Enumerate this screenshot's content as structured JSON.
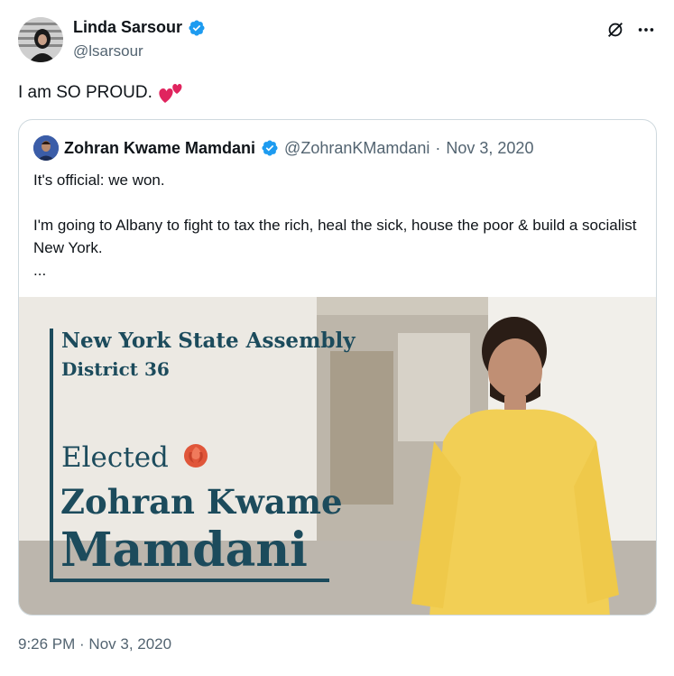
{
  "author": {
    "name": "Linda Sarsour",
    "handle": "@lsarsour"
  },
  "tweet": {
    "text": "I am SO PROUD.",
    "emoji": "two-hearts-icon"
  },
  "quoted": {
    "name": "Zohran Kwame Mamdani",
    "handle": "@ZohranKMamdani",
    "separator": "·",
    "date": "Nov 3, 2020",
    "text": "It's official: we won.\n\nI'm going to Albany to fight to tax the rich, heal the sick, house the poor & build a socialist New York.\n...",
    "media": {
      "line1": "New York State Assembly",
      "line2": "District 36",
      "elected": "Elected",
      "name1": "Zohran Kwame",
      "name2": "Mamdani"
    }
  },
  "timestamp": "9:26 PM · Nov 3, 2020",
  "colors": {
    "verified": "#1d9bf0",
    "secondary_text": "#536471",
    "border": "#cfd9de",
    "heart": "#e0245e",
    "poster_text": "#1c4b5c",
    "shirt": "#f2cf55"
  }
}
